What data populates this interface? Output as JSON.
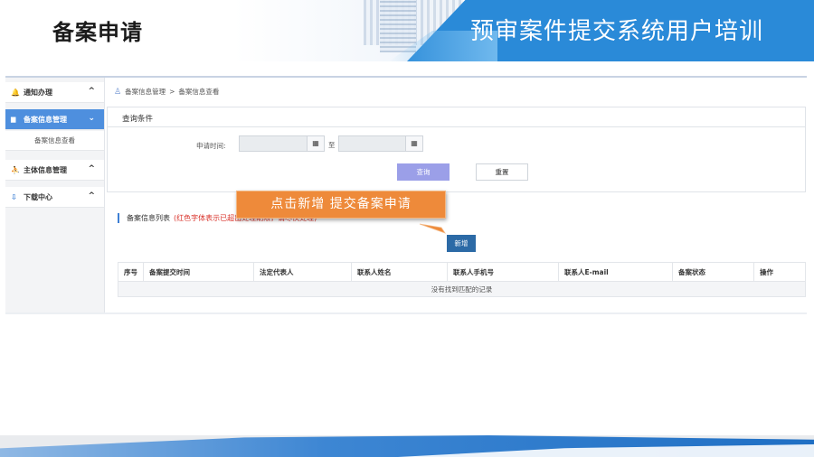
{
  "slide": {
    "title": "备案申请",
    "subtitle": "预审案件提交系统用户培训",
    "colors": {
      "banner": "#2a8ad8",
      "callout": "#ee8a3a",
      "sidebar_active": "#4e8fde",
      "primary_button": "#2c6aa6",
      "query_button": "#9b9fe8",
      "note_red": "#d9332b"
    }
  },
  "sidebar": {
    "items": [
      {
        "label": "通知办理",
        "icon": "bell-icon",
        "glyph": "🔔",
        "expanded": false
      },
      {
        "label": "备案信息管理",
        "icon": "folder-icon",
        "glyph": "▆",
        "expanded": true,
        "children": [
          {
            "label": "备案信息查看"
          }
        ]
      },
      {
        "label": "主体信息管理",
        "icon": "users-icon",
        "glyph": "⛹",
        "expanded": false
      },
      {
        "label": "下载中心",
        "icon": "download-icon",
        "glyph": "⇩",
        "expanded": false
      }
    ]
  },
  "breadcrumb": {
    "icon": "user-icon",
    "root": "备案信息管理",
    "separator": ">",
    "current": "备案信息查看"
  },
  "query": {
    "panel_title": "查询条件",
    "date_label": "申请时间:",
    "date_from": "",
    "date_to": "",
    "to_label": "至",
    "calendar_icon": "calendar-icon",
    "search_label": "查询",
    "reset_label": "重置"
  },
  "list": {
    "title": "备案信息列表",
    "note": "(红色字体表示已超出处理期限，请尽快处理)",
    "add_label": "新增",
    "columns": [
      "序号",
      "备案提交时间",
      "法定代表人",
      "联系人姓名",
      "联系人手机号",
      "联系人E-mail",
      "备案状态",
      "操作"
    ],
    "empty_text": "没有找到匹配的记录"
  },
  "callout": {
    "text": "点击新增 提交备案申请"
  }
}
